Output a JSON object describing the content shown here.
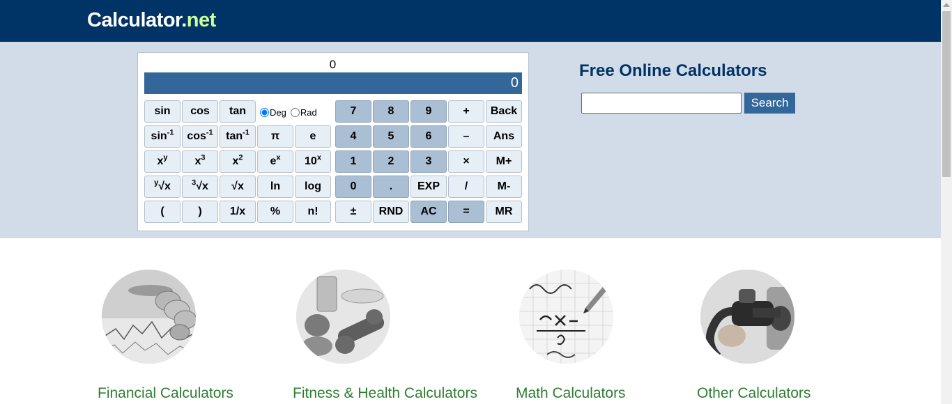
{
  "header": {
    "logo_main": "Calculator.",
    "logo_accent": "net"
  },
  "calculator": {
    "expression": "0",
    "display": "0",
    "angle_modes": {
      "deg": "Deg",
      "rad": "Rad",
      "selected": "Deg"
    },
    "keys": {
      "sin": "sin",
      "cos": "cos",
      "tan": "tan",
      "asin": "sin",
      "acos": "cos",
      "atan": "tan",
      "inverse_exp": "-1",
      "pi": "π",
      "e": "e",
      "xy_base": "x",
      "xy_exp": "y",
      "x3_base": "x",
      "x3_exp": "3",
      "x2_base": "x",
      "x2_exp": "2",
      "ex_base": "e",
      "ex_exp": "x",
      "tenx_base": "10",
      "tenx_exp": "x",
      "yroot_index": "y",
      "yroot_body": "√x",
      "cbrt_index": "3",
      "cbrt_body": "√x",
      "sqrt": "√x",
      "ln": "ln",
      "log": "log",
      "lparen": "(",
      "rparen": ")",
      "reciprocal": "1/x",
      "percent": "%",
      "factorial": "n!",
      "d7": "7",
      "d8": "8",
      "d9": "9",
      "plus": "+",
      "back": "Back",
      "d4": "4",
      "d5": "5",
      "d6": "6",
      "minus": "–",
      "ans": "Ans",
      "d1": "1",
      "d2": "2",
      "d3": "3",
      "times": "×",
      "mplus": "M+",
      "d0": "0",
      "dot": ".",
      "exp": "EXP",
      "divide": "/",
      "mminus": "M-",
      "plusminus": "±",
      "rnd": "RND",
      "ac": "AC",
      "equals": "=",
      "mr": "MR"
    }
  },
  "panel": {
    "title": "Free Online Calculators",
    "search_button": "Search",
    "search_placeholder": ""
  },
  "categories": [
    {
      "label": "Financial Calculators",
      "image": "coins-and-chart-image"
    },
    {
      "label": "Fitness & Health Calculators",
      "image": "fitness-food-image"
    },
    {
      "label": "Math Calculators",
      "image": "math-formula-image"
    },
    {
      "label": "Other Calculators",
      "image": "fuel-nozzle-image"
    }
  ],
  "colors": {
    "header_bg": "#003366",
    "logo_accent": "#ccff99",
    "band_bg": "#d1dce8",
    "display_bg": "#336699",
    "key_bg": "#e6eef6",
    "num_key_bg": "#abbfd4",
    "category_link": "#2e7d32"
  }
}
